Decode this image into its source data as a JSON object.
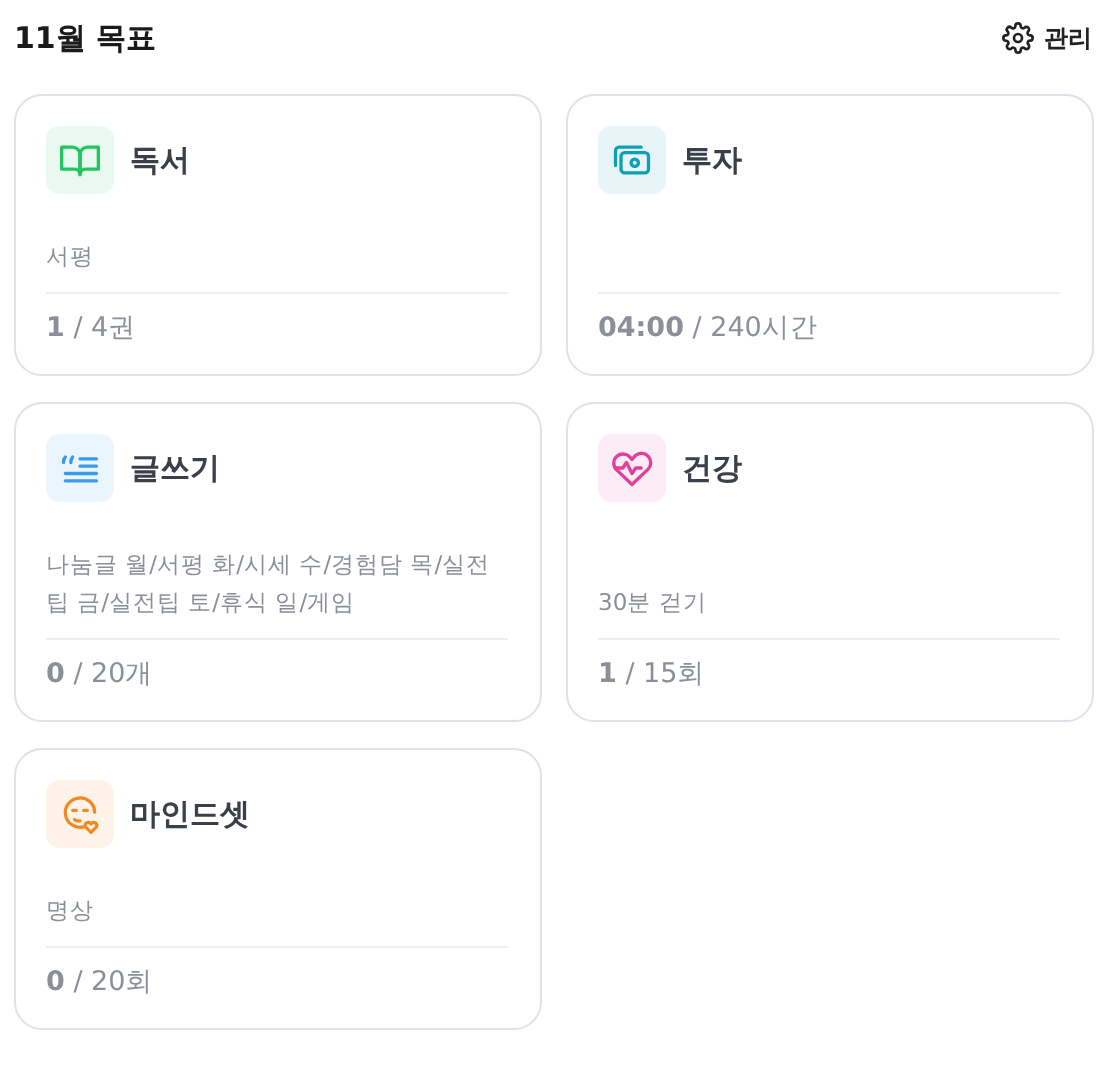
{
  "header": {
    "title": "11월 목표",
    "manage_button": "관리"
  },
  "goals": [
    {
      "kind": "book",
      "color": "#22c55e",
      "title": "독서",
      "description": "서평",
      "progress": "**1** / 4권"
    },
    {
      "kind": "cash",
      "color": "#0e9fb5",
      "title": "투자",
      "progress": "**04:00** / 240시간"
    },
    {
      "kind": "writing",
      "color": "#3b9be8",
      "title": "글쓰기",
      "description": "나눔글 월/서평 화/시세 수/경험담 목/실전팁 금/실전팁 토/휴식 일/게임",
      "progress": "**0** / 20개"
    },
    {
      "kind": "health",
      "color": "#e0409a",
      "title": "건강",
      "description": "30분 걷기",
      "progress": "**1** / 15회"
    },
    {
      "kind": "mind",
      "color": "#f08a24",
      "title": "마인드셋",
      "description": "명상",
      "progress": "**0** / 20회"
    }
  ]
}
